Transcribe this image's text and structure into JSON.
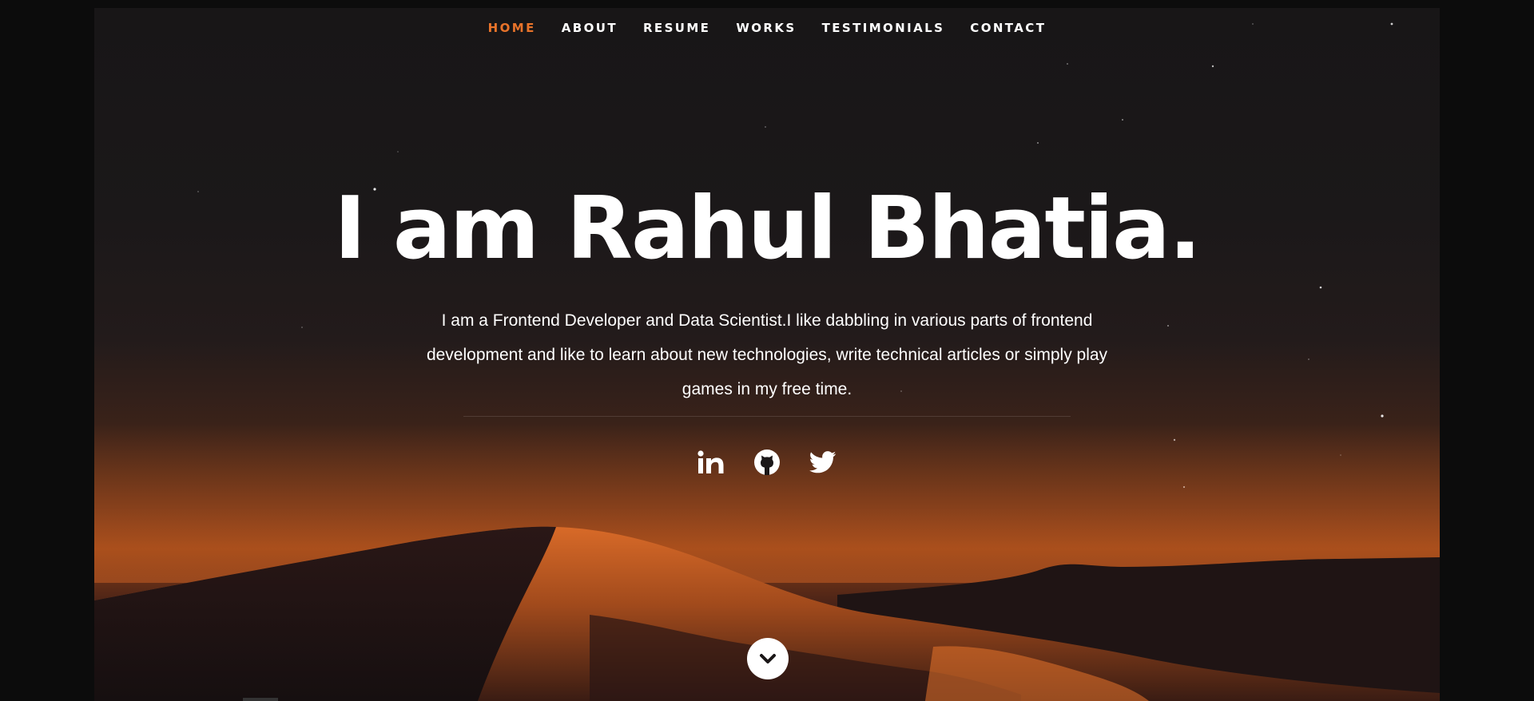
{
  "nav": {
    "items": [
      {
        "label": "HOME",
        "active": true
      },
      {
        "label": "ABOUT",
        "active": false
      },
      {
        "label": "RESUME",
        "active": false
      },
      {
        "label": "WORKS",
        "active": false
      },
      {
        "label": "TESTIMONIALS",
        "active": false
      },
      {
        "label": "CONTACT",
        "active": false
      }
    ],
    "active_color": "#e8732a"
  },
  "hero": {
    "headline": "I am Rahul Bhatia.",
    "intro": "I am a Frontend Developer and Data Scientist.I like dabbling in various parts of frontend development and like to learn about new technologies, write technical articles or simply play games in my free time."
  },
  "social": [
    {
      "icon": "linkedin-icon"
    },
    {
      "icon": "github-icon"
    },
    {
      "icon": "twitter-icon"
    }
  ],
  "scroll_button": {
    "icon": "chevron-down-icon"
  },
  "colors": {
    "accent": "#e8732a",
    "background": "#181617",
    "text": "#ffffff"
  }
}
